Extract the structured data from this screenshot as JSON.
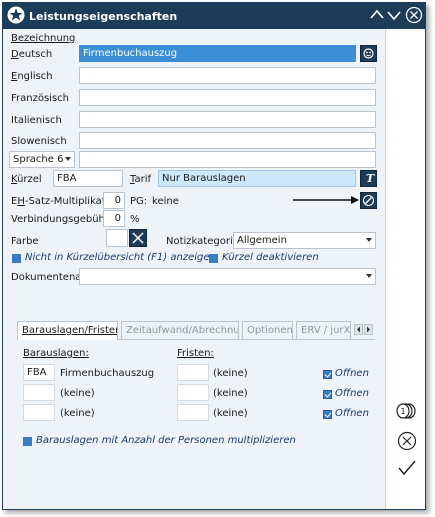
{
  "window": {
    "title": "Leistungseigenschaften"
  },
  "bezeichnung": {
    "section": "Bezeichnung",
    "deutsch_label": "Deutsch",
    "deutsch_value": "Firmenbuchauszug",
    "englisch_label": "Englisch",
    "franzoesisch_label": "Französisch",
    "italienisch_label": "Italienisch",
    "slowenisch_label": "Slowenisch",
    "sprache_select": "Sprache 6"
  },
  "fields": {
    "kuerzel_label": "Kürzel",
    "kuerzel_value": "FBA",
    "tarif_label": "Tarif",
    "tarif_value": "Nur Barauslagen",
    "eh_label": "EH-Satz-Multiplikator",
    "eh_value": "0",
    "pg_label": "PG:",
    "pg_value": "keine",
    "verbindung_label": "Verbindungsgebühr",
    "verbindung_value": "0",
    "percent": "%",
    "farbe_label": "Farbe",
    "notiz_label": "Notizkategorie",
    "notiz_value": "Allgemein",
    "nicht_label": "Nicht in Kürzelübersicht (F1) anzeigen",
    "deaktiv_label": "Kürzel deaktivieren",
    "dokument_label": "Dokumentenart",
    "dokument_value": ""
  },
  "tabs": [
    {
      "label": "Barauslagen/Fristen"
    },
    {
      "label": "Zeitaufwand/Abrechnung"
    },
    {
      "label": "Optionen"
    },
    {
      "label": "ERV / jurXp"
    }
  ],
  "panel": {
    "barauslagen_header": "Barauslagen:",
    "fristen_header": "Fristen:",
    "rows": [
      {
        "code": "FBA",
        "name": "Firmenbuchauszug",
        "frist": "(keine)",
        "offnen": "Offnen"
      },
      {
        "code": "",
        "name": "(keine)",
        "frist": "(keine)",
        "offnen": "Offnen"
      },
      {
        "code": "",
        "name": "(keine)",
        "frist": "(keine)",
        "offnen": "Offnen"
      }
    ],
    "multiply_label": "Barauslagen mit Anzahl der Personen multiplizieren"
  },
  "colors": {
    "titlebar": "#1c3c5a",
    "accent": "#3a8fd6",
    "checkbox": "#3a7cc4"
  }
}
